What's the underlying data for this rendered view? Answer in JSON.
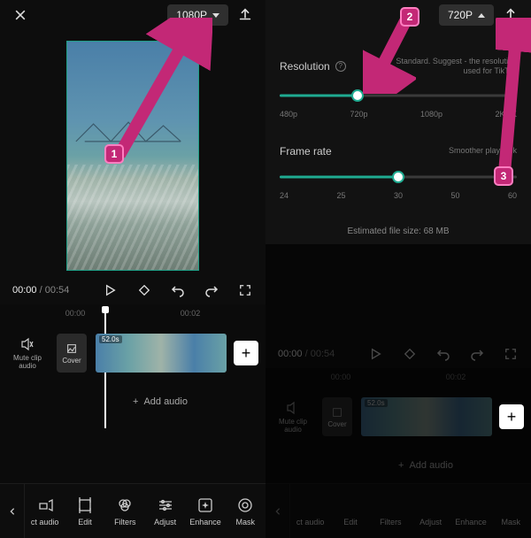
{
  "left": {
    "resolution_label": "1080P",
    "time_current": "00:00",
    "time_total": "00:54",
    "ruler": {
      "t0": "00:00",
      "t1": "00:02"
    },
    "mute_label": "Mute clip audio",
    "cover_label": "Cover",
    "clip_duration": "52.0s",
    "add_audio_label": "Add audio"
  },
  "right": {
    "resolution_label": "720P",
    "settings": {
      "resolution_title": "Resolution",
      "resolution_hint": "Standard. Suggest - the resolution used for TikTok",
      "res_ticks": [
        "480p",
        "720p",
        "1080p",
        "2K/4K"
      ],
      "framerate_title": "Frame rate",
      "framerate_hint": "Smoother playback",
      "fr_ticks": [
        "24",
        "25",
        "30",
        "50",
        "60"
      ],
      "estimate": "Estimated file size: 68 MB"
    },
    "time_current": "00:00",
    "time_total": "00:54",
    "ruler": {
      "t0": "00:00",
      "t1": "00:02"
    },
    "mute_label": "Mute clip audio",
    "cover_label": "Cover",
    "clip_duration": "52.0s",
    "add_audio_label": "Add audio"
  },
  "toolbar": {
    "items": [
      "ct audio",
      "Edit",
      "Filters",
      "Adjust",
      "Enhance",
      "Mask"
    ]
  },
  "markers": {
    "m1": "1",
    "m2": "2",
    "m3": "3"
  },
  "plus": "+"
}
